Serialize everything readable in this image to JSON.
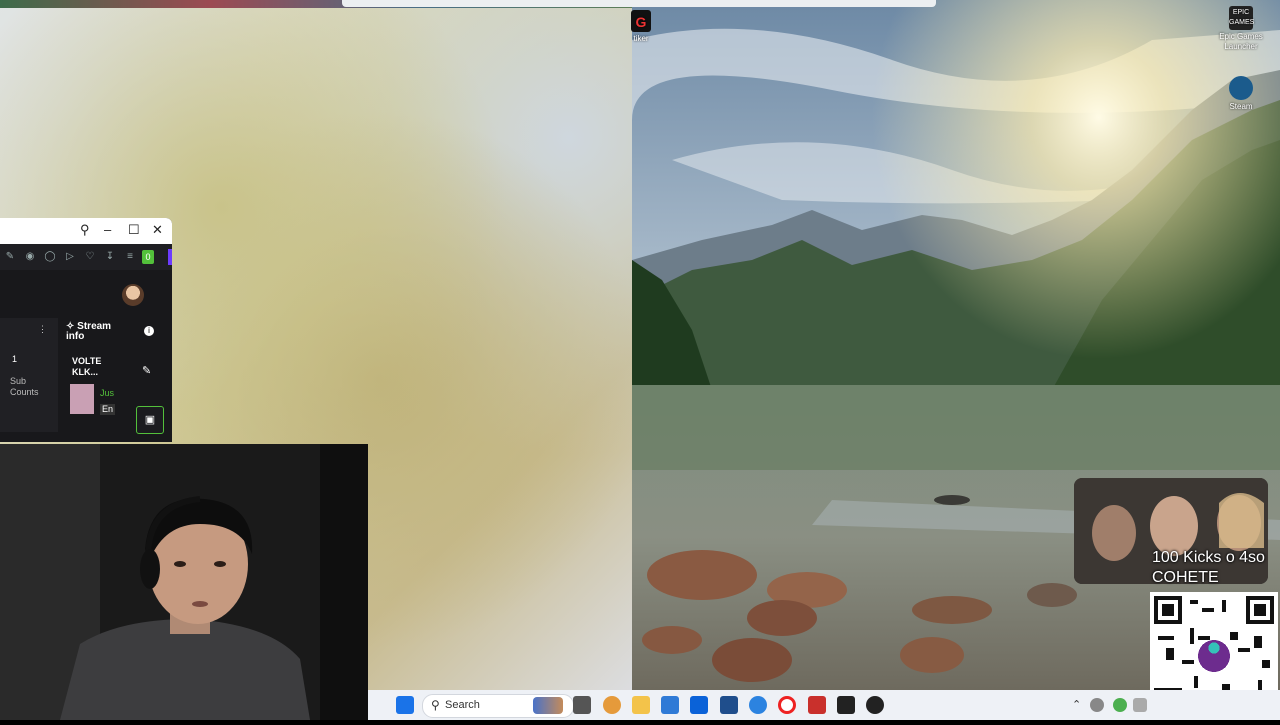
{
  "desktop": {
    "icons": [
      {
        "label": "Epic Games Launcher",
        "icon": "epic-games-icon"
      },
      {
        "label": "Steam",
        "icon": "steam-icon"
      },
      {
        "label": "tiker",
        "icon": "g-app-icon"
      }
    ]
  },
  "app_window": {
    "toolbar_badge": "0",
    "left_panel": {
      "count": "1",
      "label": "Sub Counts"
    },
    "stream_info": {
      "title": "Stream info",
      "stream_title": "VOLTE KLK...",
      "tag_green": "Jus",
      "tag_gray": "En"
    }
  },
  "overlay": {
    "text": "100 Kicks o 4so COHETE",
    "qr_brand": "yape"
  },
  "taskbar": {
    "search_placeholder": "Search"
  },
  "colors": {
    "accent_green": "#53c03b",
    "purple": "#6d3bff",
    "taskbar_bg": "#eef1f6"
  }
}
